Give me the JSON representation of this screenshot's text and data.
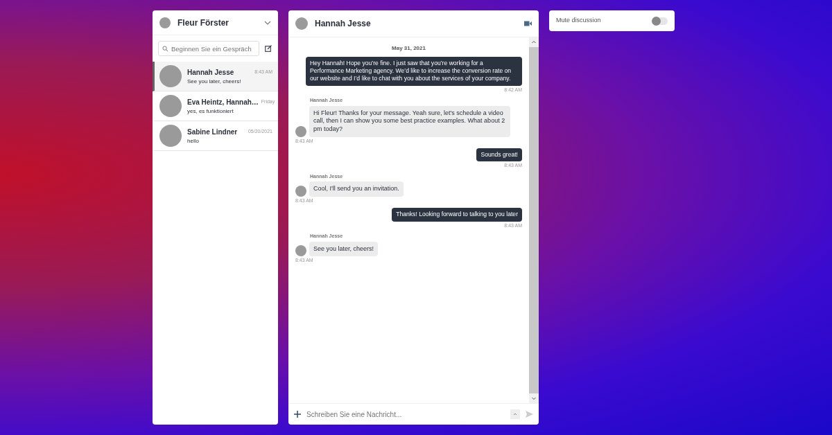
{
  "account": {
    "name": "Fleur Förster"
  },
  "search": {
    "placeholder": "Beginnen Sie ein Gespräch"
  },
  "conversations": [
    {
      "name": "Hannah Jesse",
      "time": "8:43 AM",
      "preview": "See you later, cheers!",
      "selected": true
    },
    {
      "name": "Eva Heintz, Hannah…",
      "time": "Friday",
      "preview": "yes, es funktioniert",
      "selected": false
    },
    {
      "name": "Sabine Lindner",
      "time": "05/20/2021",
      "preview": "hello",
      "selected": false
    }
  ],
  "chat": {
    "title": "Hannah Jesse",
    "date": "May 31, 2021",
    "messages": [
      {
        "kind": "out",
        "text": "Hey Hannah! Hope you’re fine. I just saw that you’re working for a Performance Marketing agency. We’d like to increase the conversion rate on our website and I’d like to chat with you about the services of your company.",
        "time": "8:42 AM"
      },
      {
        "kind": "in",
        "sender": "Hannah Jesse",
        "text": "Hi Fleur! Thanks for your message. Yeah sure, let's schedule a video call, then I can show you some best practice examples. What about 2 pm today?",
        "time": "8:43 AM"
      },
      {
        "kind": "out",
        "text": "Sounds great!",
        "time": "8:43 AM"
      },
      {
        "kind": "in",
        "sender": "Hannah Jesse",
        "text": "Cool, I'll send you an invitation.",
        "time": "8:43 AM"
      },
      {
        "kind": "out",
        "text": "Thanks! Looking forward to talking to you later",
        "time": "8:43 AM"
      },
      {
        "kind": "in",
        "sender": "Hannah Jesse",
        "text": "See you later, cheers!",
        "time": "8:43 AM"
      }
    ],
    "composer": {
      "placeholder": "Schreiben Sie eine Nachricht..."
    }
  },
  "mute": {
    "label": "Mute discussion",
    "on": false
  }
}
